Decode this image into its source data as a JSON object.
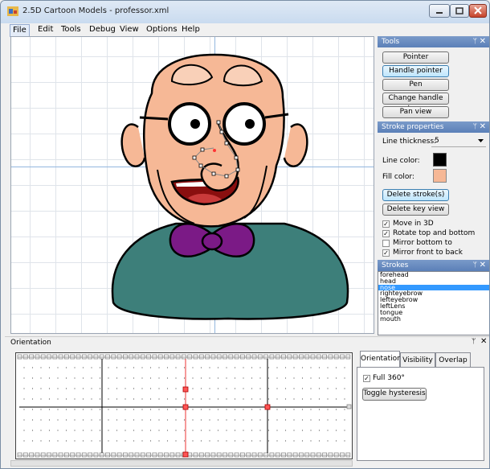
{
  "window": {
    "title": "2.5D Cartoon Models - professor.xml"
  },
  "menu": [
    "File",
    "Edit",
    "Tools",
    "Debug",
    "View",
    "Options",
    "Help"
  ],
  "tools_panel": {
    "title": "Tools",
    "buttons": [
      "Pointer",
      "Handle pointer",
      "Pen",
      "Change handle type",
      "Pan view"
    ],
    "selected": "Handle pointer"
  },
  "stroke_panel": {
    "title": "Stroke properties",
    "line_thickness_label": "Line thickness:",
    "line_thickness_value": "5",
    "line_color_label": "Line color:",
    "fill_color_label": "Fill color:",
    "line_color": "#000000",
    "fill_color": "#f6b896",
    "delete_strokes": "Delete stroke(s)",
    "delete_key_view": "Delete key view",
    "checkboxes": [
      {
        "label": "Move in 3D",
        "checked": true
      },
      {
        "label": "Rotate top and bottom",
        "checked": true
      },
      {
        "label": "Mirror bottom to",
        "checked": false
      },
      {
        "label": "Mirror front to back",
        "checked": true
      }
    ]
  },
  "strokes_panel": {
    "title": "Strokes",
    "items": [
      "forehead",
      "head",
      "nose",
      "righteyebrow",
      "lefteyebrow",
      "leftLens",
      "tongue",
      "mouth"
    ],
    "selected": "nose"
  },
  "orientation_panel": {
    "title": "Orientation",
    "tabs": [
      "Orientation",
      "Visibility",
      "Overlap"
    ],
    "active_tab": "Orientation",
    "full360_label": "Full 360°",
    "full360_checked": true,
    "toggle_label": "Toggle hysteresis"
  },
  "colors": {
    "panel_header": "#6a8cc0",
    "accent": "#3399ff",
    "skin": "#f6b896",
    "sweater": "#3d7f7a",
    "bowtie": "#7b1a86"
  }
}
